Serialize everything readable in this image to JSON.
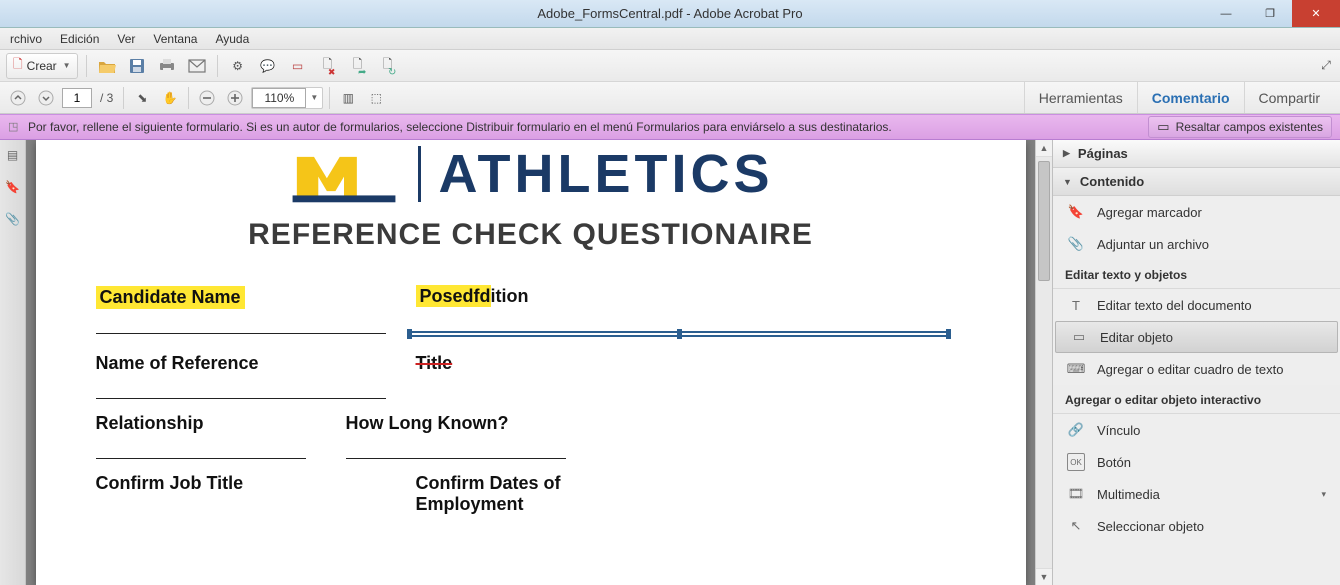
{
  "window": {
    "title": "Adobe_FormsCentral.pdf - Adobe Acrobat Pro"
  },
  "menus": {
    "archivo": "rchivo",
    "edicion": "Edición",
    "ver": "Ver",
    "ventana": "Ventana",
    "ayuda": "Ayuda"
  },
  "toolbar": {
    "crear": "Crear"
  },
  "nav": {
    "page_current": "1",
    "page_total": "/ 3",
    "zoom": "110%"
  },
  "rightlinks": {
    "herramientas": "Herramientas",
    "comentario": "Comentario",
    "compartir": "Compartir"
  },
  "notice": {
    "text": "Por favor, rellene el siguiente formulario. Si es un autor de formularios, seleccione Distribuir formulario en el menú Formularios para enviárselo a sus destinatarios.",
    "highlight_btn": "Resaltar campos existentes"
  },
  "doc": {
    "logo_text": "ATHLETICS",
    "title": "REFERENCE CHECK QUESTIONAIRE",
    "fields": {
      "candidate_name": "Candidate Name",
      "position": "Posedfdition",
      "name_of_reference": "Name of Reference",
      "title": "Title",
      "relationship": "Relationship",
      "how_long_known": "How Long Known?",
      "confirm_job_title": "Confirm Job Title",
      "confirm_dates_1": "Confirm Dates of",
      "confirm_dates_2": "Employment"
    }
  },
  "panel": {
    "paginas": "Páginas",
    "contenido": "Contenido",
    "agregar_marcador": "Agregar marcador",
    "adjuntar_archivo": "Adjuntar un archivo",
    "editar_texto_objetos": "Editar texto y objetos",
    "editar_texto_doc": "Editar texto del documento",
    "editar_objeto": "Editar objeto",
    "agregar_cuadro": "Agregar o editar cuadro de texto",
    "objeto_interactivo": "Agregar o editar objeto interactivo",
    "vinculo": "Vínculo",
    "boton": "Botón",
    "multimedia": "Multimedia",
    "seleccionar_objeto": "Seleccionar objeto"
  }
}
